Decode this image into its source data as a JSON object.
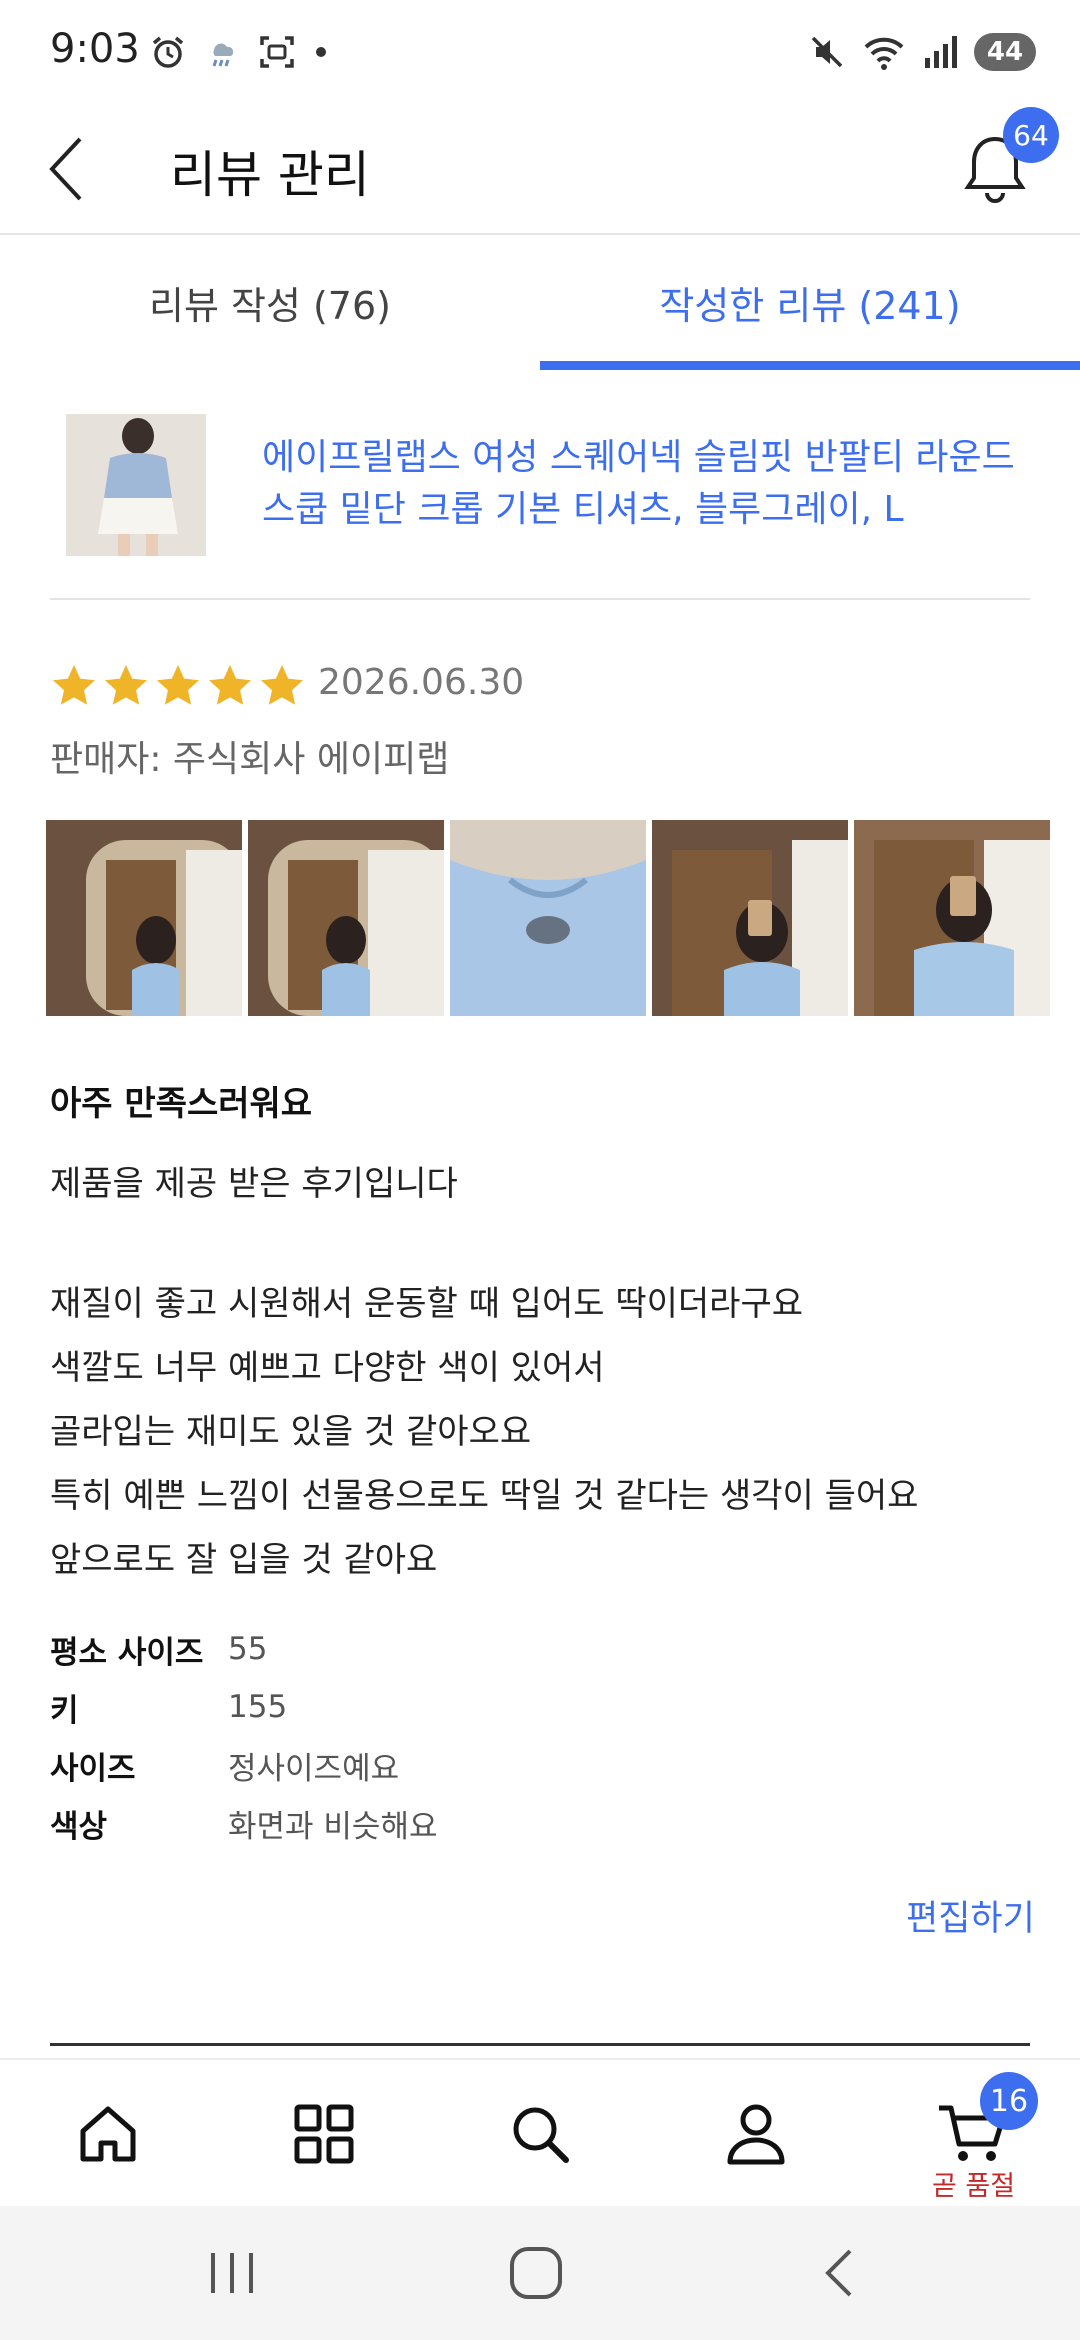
{
  "status_bar": {
    "time": "9:03",
    "battery": "44"
  },
  "header": {
    "title": "리뷰 관리",
    "notification_count": "64"
  },
  "tabs": [
    {
      "label": "리뷰 작성 (76)",
      "active": false
    },
    {
      "label": "작성한 리뷰 (241)",
      "active": true
    }
  ],
  "product": {
    "title_line1": "에이프릴랩스 여성 스퀘어넥 슬림핏 반팔티 라운드",
    "title_line2": "스쿱 밑단 크롭 기본 티셔츠, 블루그레이, L"
  },
  "review": {
    "rating": 5,
    "date": "2026.06.30",
    "seller": "판매자: 주식회사 에이피랩",
    "title": "아주 만족스러워요",
    "lines": [
      "제품을 제공 받은 후기입니다",
      "",
      "재질이 좋고 시원해서 운동할 때 입어도 딱이더라구요",
      "색깔도 너무 예쁘고 다양한 색이 있어서",
      "골라입는 재미도 있을 것 같아오요",
      "특히 예쁜 느낌이 선물용으로도 딱일 것 같다는 생각이 들어요",
      "앞으로도 잘 입을 것 같아요"
    ],
    "attributes": [
      {
        "label": "평소 사이즈",
        "value": "55"
      },
      {
        "label": "키",
        "value": "155"
      },
      {
        "label": "사이즈",
        "value": "정사이즈예요"
      },
      {
        "label": "색상",
        "value": "화면과 비슷해요"
      }
    ],
    "edit_label": "편집하기"
  },
  "bottom_nav": {
    "items": [
      "home-icon",
      "categories-icon",
      "search-icon",
      "profile-icon",
      "cart-icon"
    ],
    "cart_count": "16",
    "cart_caption": "곧 품절"
  },
  "colors": {
    "accent": "#3e6ef0",
    "star": "#f0b429",
    "warning": "#c62828"
  }
}
